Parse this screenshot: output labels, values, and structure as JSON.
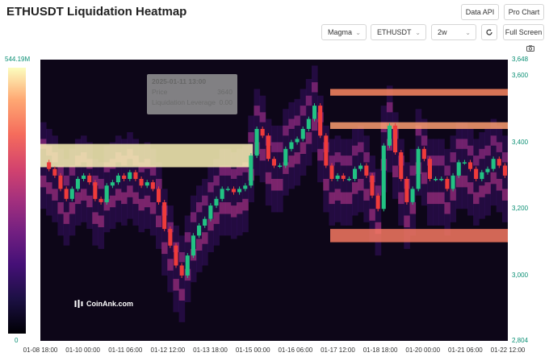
{
  "header": {
    "title": "ETHUSDT Liquidation Heatmap",
    "data_api_label": "Data API",
    "pro_chart_label": "Pro Chart",
    "full_screen_label": "Full Screen"
  },
  "controls": {
    "palette": "Magma",
    "symbol": "ETHUSDT",
    "timeframe": "2w"
  },
  "colorbar": {
    "max_label": "544.19M",
    "min_label": "0",
    "colormap": "magma"
  },
  "tooltip": {
    "datetime": "2025-01-11 13:00",
    "price_label": "Price",
    "price_value": "3640",
    "leverage_label": "Liquidation Leverage",
    "leverage_value": "0.00"
  },
  "watermark": "CoinAnk.com",
  "colors": {
    "up_candle": "#22c283",
    "down_candle": "#ef3b3b",
    "axis_text": "#0a8f74"
  },
  "icons": [
    "camera-icon",
    "refresh-icon",
    "chevron-down-icon",
    "coinank-logo-icon"
  ],
  "chart_data": {
    "type": "heatmap",
    "x_ticks": [
      "01-08 18:00",
      "01-10 00:00",
      "01-11 06:00",
      "01-12 12:00",
      "01-13 18:00",
      "01-15 00:00",
      "01-16 06:00",
      "01-17 12:00",
      "01-18 18:00",
      "01-20 00:00",
      "01-21 06:00",
      "01-22 12:00"
    ],
    "y_ticks": [
      "3,648",
      "3,600",
      "3,400",
      "3,200",
      "3,000",
      "2,804"
    ],
    "ylim": [
      2804,
      3648
    ],
    "price_series": [
      3340,
      3320,
      3300,
      3260,
      3230,
      3260,
      3290,
      3300,
      3280,
      3230,
      3220,
      3270,
      3280,
      3300,
      3290,
      3310,
      3290,
      3270,
      3280,
      3260,
      3220,
      3140,
      3090,
      3030,
      3000,
      3060,
      3120,
      3150,
      3170,
      3210,
      3230,
      3260,
      3260,
      3250,
      3260,
      3270,
      3360,
      3440,
      3420,
      3350,
      3330,
      3330,
      3380,
      3400,
      3410,
      3440,
      3470,
      3510,
      3420,
      3330,
      3290,
      3300,
      3290,
      3290,
      3320,
      3330,
      3300,
      3240,
      3200,
      3390,
      3450,
      3370,
      3290,
      3220,
      3260,
      3380,
      3350,
      3290,
      3290,
      3290,
      3260,
      3300,
      3340,
      3340,
      3320,
      3290,
      3310,
      3320,
      3350,
      3330,
      3300
    ],
    "liquidation_bands": [
      {
        "price_low": 3395,
        "price_high": 3325,
        "x_end": "01-15 00:00",
        "intensity": 0.98
      },
      {
        "price_low": 3560,
        "price_high": 3540,
        "x_end": "01-22 12:00",
        "intensity": 0.75
      },
      {
        "price_low": 3460,
        "price_high": 3440,
        "x_end": "01-22 12:00",
        "intensity": 0.8
      },
      {
        "price_low": 3140,
        "price_high": 3100,
        "x_end": "01-22 12:00",
        "intensity": 0.72
      }
    ]
  }
}
